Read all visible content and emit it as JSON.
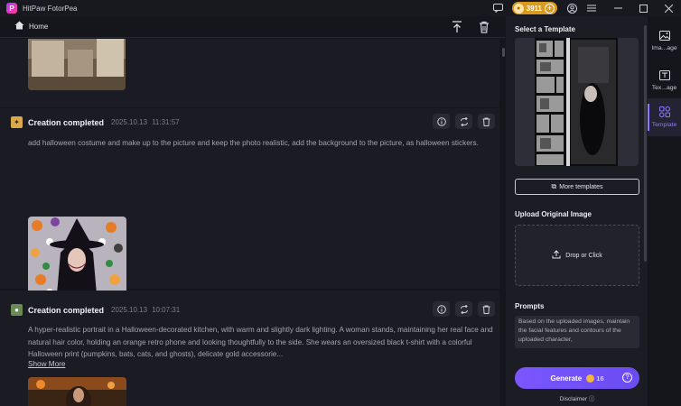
{
  "app": {
    "title": "HitPaw FotorPea",
    "logo_letter": "P"
  },
  "titlebar": {
    "credits": "3911"
  },
  "header": {
    "home_label": "Home"
  },
  "feed": {
    "cards": [
      {
        "title": "Creation completed",
        "date": "2025.10.13",
        "time": "11:31:57",
        "prompt": "add halloween costume and make up to the picture and keep the photo realistic, add the background to the picture, as halloween stickers."
      },
      {
        "title": "Creation completed",
        "date": "2025.10.13",
        "time": "10:07:31",
        "prompt": "A hyper-realistic portrait in a Halloween-decorated kitchen, with warm and slightly dark lighting. A woman stands, maintaining her real face and natural hair color, holding an orange retro phone and looking thoughtfully to the side. She wears an oversized black t-shirt with a colorful Halloween print (pumpkins, bats, cats, and ghosts), delicate gold accessorie...",
        "show_more": "Show More"
      }
    ]
  },
  "panel": {
    "select_template_title": "Select a Template",
    "more_templates": "More templates",
    "upload_title": "Upload Original Image",
    "upload_hint": "Drop or Click",
    "prompts_title": "Prompts",
    "prompt_text": "Based on the uploaded images, maintain the facial features and contours of the uploaded character,",
    "generate_label": "Generate",
    "generate_cost": "16",
    "disclaimer": "Disclaimer"
  },
  "sidetabs": [
    {
      "label": "Ima...age",
      "icon": "image-to-image-icon"
    },
    {
      "label": "Tex...age",
      "icon": "text-to-image-icon"
    },
    {
      "label": "Template",
      "icon": "template-icon",
      "active": true
    }
  ],
  "colors": {
    "accent": "#7a56ff",
    "coin": "#d99a1d",
    "bg": "#15151c",
    "panel": "#1c1c25"
  }
}
